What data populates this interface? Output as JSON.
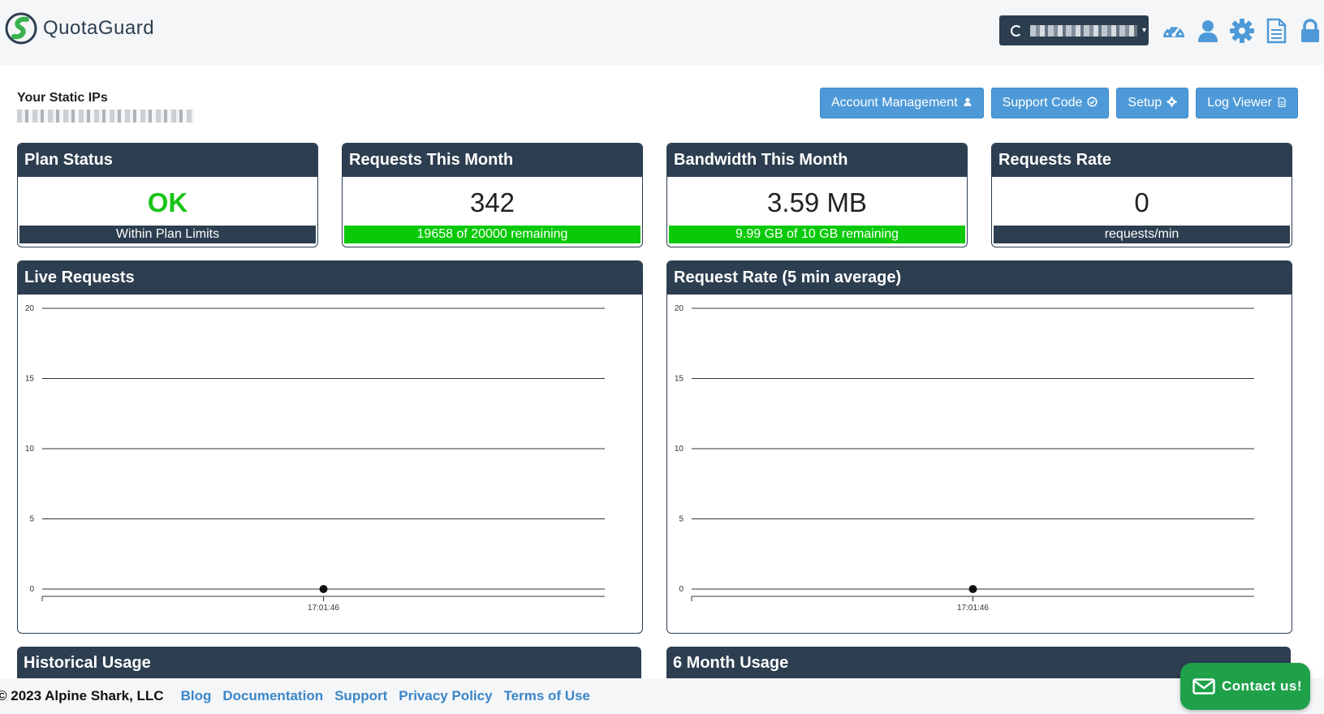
{
  "brand": {
    "name": "QuotaGuard"
  },
  "header": {
    "account_selector_caret": "▾",
    "icons": [
      "dashboard-icon",
      "user-icon",
      "gear-icon",
      "document-icon",
      "lock-icon"
    ]
  },
  "static_ips": {
    "label": "Your Static IPs"
  },
  "actions": {
    "account_management": "Account Management",
    "support_code": "Support Code",
    "setup": "Setup",
    "log_viewer": "Log Viewer"
  },
  "cards": {
    "plan_status": {
      "title": "Plan Status",
      "value": "OK",
      "footer": "Within Plan Limits"
    },
    "requests_month": {
      "title": "Requests This Month",
      "value": "342",
      "footer": "19658 of 20000 remaining"
    },
    "bandwidth_month": {
      "title": "Bandwidth This Month",
      "value": "3.59 MB",
      "footer": "9.99 GB of 10 GB remaining"
    },
    "requests_rate": {
      "title": "Requests Rate",
      "value": "0",
      "footer": "requests/min"
    }
  },
  "panels": {
    "live_requests": {
      "title": "Live Requests"
    },
    "request_rate": {
      "title": "Request Rate (5 min average)"
    },
    "historical_usage": {
      "title": "Historical Usage"
    },
    "six_month_usage": {
      "title": "6 Month Usage"
    }
  },
  "chart_data": [
    {
      "type": "line",
      "title": "Live Requests",
      "ylim": [
        0,
        20
      ],
      "yticks": [
        0,
        5,
        10,
        15,
        20
      ],
      "x": [
        "17:01:46"
      ],
      "series": [
        {
          "values": [
            0
          ]
        }
      ],
      "grid": true
    },
    {
      "type": "line",
      "title": "Request Rate (5 min average)",
      "ylim": [
        0,
        20
      ],
      "yticks": [
        0,
        5,
        10,
        15,
        20
      ],
      "x": [
        "17:01:46"
      ],
      "series": [
        {
          "values": [
            0
          ]
        }
      ],
      "grid": true
    }
  ],
  "footer": {
    "copyright": "© 2023 Alpine Shark, LLC",
    "links": [
      "Blog",
      "Documentation",
      "Support",
      "Privacy Policy",
      "Terms of Use"
    ]
  },
  "contact": {
    "label": "Contact us!"
  },
  "colors": {
    "navy": "#2c3e50",
    "button_blue": "#4e9ad8",
    "ok_green": "#18c418",
    "bar_green": "#09c909",
    "contact_green": "#1fa14a",
    "link_blue": "#3a86c8"
  }
}
